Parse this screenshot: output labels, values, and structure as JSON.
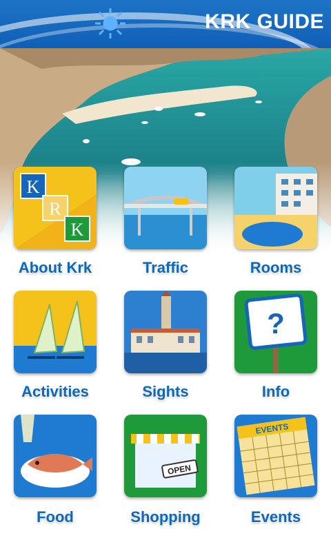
{
  "header": {
    "title": "KRK GUIDE"
  },
  "menu": [
    {
      "label": "About Krk"
    },
    {
      "label": "Traffic"
    },
    {
      "label": "Rooms"
    },
    {
      "label": "Activities"
    },
    {
      "label": "Sights"
    },
    {
      "label": "Info"
    },
    {
      "label": "Food"
    },
    {
      "label": "Shopping"
    },
    {
      "label": "Events"
    }
  ],
  "tile_text": {
    "krk_k1": "K",
    "krk_r": "R",
    "krk_k2": "K",
    "open_sign": "OPEN",
    "events_banner": "EVENTS"
  },
  "colors": {
    "header_blue": "#0f5fb6",
    "label_blue": "#0e67b7",
    "accent_yellow": "#f4c21b",
    "accent_green": "#1e9a3a"
  }
}
